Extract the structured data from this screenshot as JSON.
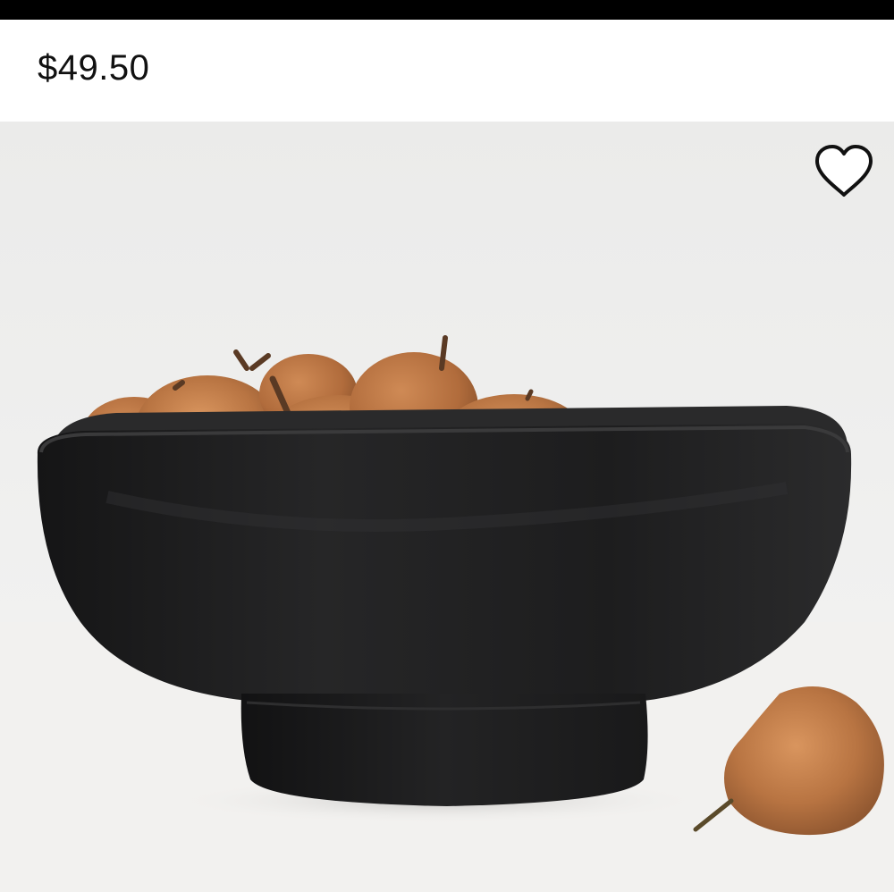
{
  "product": {
    "price": "$49.50"
  },
  "image": {
    "subject": "black-bowl-with-pears",
    "colors": {
      "wall": "#ececea",
      "surface": "#f3f2f0",
      "bowl": "#1e1e1f",
      "pear": "#b06a3a"
    }
  },
  "actions": {
    "favorite_icon": "heart-outline-icon"
  }
}
